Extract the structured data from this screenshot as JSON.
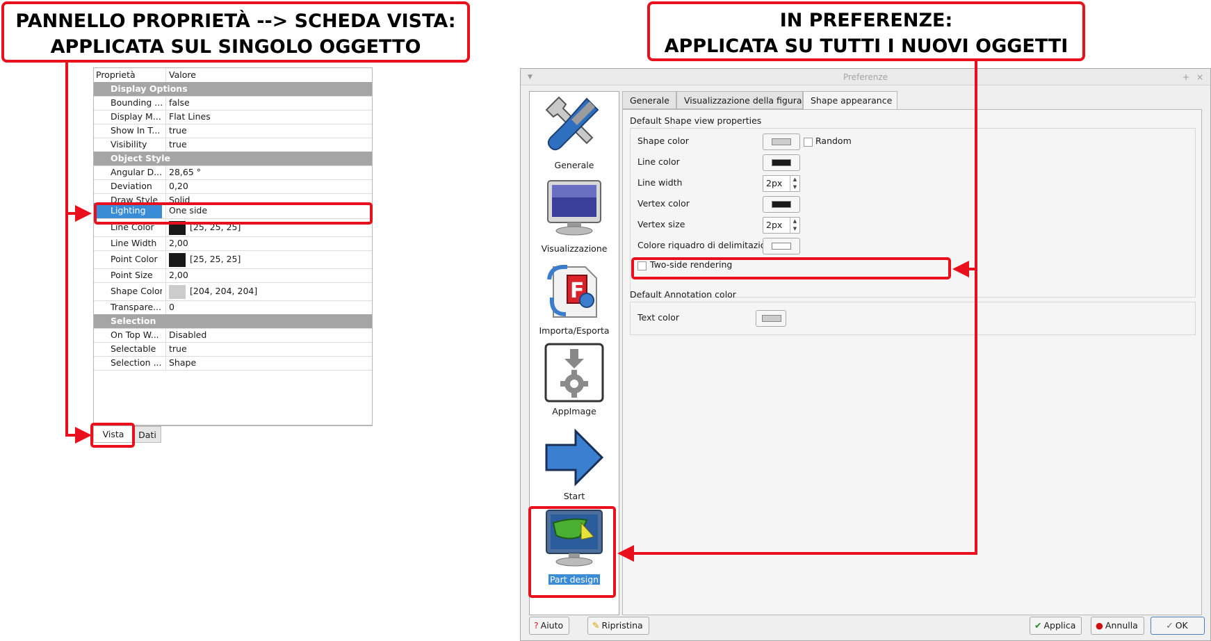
{
  "callouts": {
    "left_line1": "PANNELLO PROPRIETÀ --> SCHEDA VISTA:",
    "left_line2": "APPLICATA SUL SINGOLO OGGETTO",
    "right_line1": "IN PREFERENZE:",
    "right_line2": "APPLICATA SU TUTTI I NUOVI OGGETTI"
  },
  "property_panel": {
    "header_property": "Proprietà",
    "header_value": "Valore",
    "groups": {
      "display_options": "Display Options",
      "object_style": "Object Style",
      "selection": "Selection"
    },
    "rows": {
      "bounding": {
        "key": "Bounding ...",
        "value": "false"
      },
      "display_mode": {
        "key": "Display M...",
        "value": "Flat Lines"
      },
      "show_in_tree": {
        "key": "Show In T...",
        "value": "true"
      },
      "visibility": {
        "key": "Visibility",
        "value": "true"
      },
      "angular_deflection": {
        "key": "Angular D...",
        "value": "28,65 °"
      },
      "deviation": {
        "key": "Deviation",
        "value": "0,20"
      },
      "draw_style": {
        "key": "Draw Style",
        "value": "Solid"
      },
      "lighting": {
        "key": "Lighting",
        "value": "One side"
      },
      "line_color": {
        "key": "Line Color",
        "value": "[25, 25, 25]"
      },
      "line_width": {
        "key": "Line Width",
        "value": "2,00"
      },
      "point_color": {
        "key": "Point Color",
        "value": "[25, 25, 25]"
      },
      "point_size": {
        "key": "Point Size",
        "value": "2,00"
      },
      "shape_color": {
        "key": "Shape Color",
        "value": "[204, 204, 204]"
      },
      "transparency": {
        "key": "Transpare...",
        "value": "0"
      },
      "on_top_when": {
        "key": "On Top W...",
        "value": "Disabled"
      },
      "selectable": {
        "key": "Selectable",
        "value": "true"
      },
      "selection_style": {
        "key": "Selection ...",
        "value": "Shape"
      }
    },
    "tabs": {
      "vista": "Vista",
      "dati": "Dati"
    },
    "colors": {
      "line": "#191919",
      "point": "#191919",
      "shape": "#cccccc",
      "selected_row": "#3b8cd6",
      "group_bg": "#a5a5a5"
    }
  },
  "preferences": {
    "title": "Preferenze",
    "sidebar": [
      {
        "label": "Generale",
        "icon": "tools-icon"
      },
      {
        "label": "Visualizzazione",
        "icon": "monitor-icon"
      },
      {
        "label": "Importa/Esporta",
        "icon": "import-export-icon"
      },
      {
        "label": "AppImage",
        "icon": "appimage-icon"
      },
      {
        "label": "Start",
        "icon": "arrow-right-icon"
      },
      {
        "label": "Part design",
        "icon": "part-design-icon"
      }
    ],
    "tabs": {
      "generale": "Generale",
      "visualizzazione": "Visualizzazione della figura",
      "shape": "Shape appearance"
    },
    "shape_section_title": "Default Shape view properties",
    "fields": {
      "shape_color": "Shape color",
      "random": "Random",
      "line_color": "Line color",
      "line_width": "Line width",
      "line_width_value": "2px",
      "vertex_color": "Vertex color",
      "vertex_size": "Vertex size",
      "vertex_size_value": "2px",
      "bbox_color": "Colore riquadro di delimitazione",
      "two_side": "Two-side rendering"
    },
    "annotation_section_title": "Default Annotation color",
    "text_color": "Text color",
    "buttons": {
      "help": "Aiuto",
      "reset": "Ripristina",
      "apply": "Applica",
      "cancel": "Annulla",
      "ok": "OK"
    },
    "colors": {
      "shape": "#cccccc",
      "line": "#191919",
      "vertex": "#191919",
      "bbox": "#ffffff",
      "text": "#cccccc"
    }
  }
}
